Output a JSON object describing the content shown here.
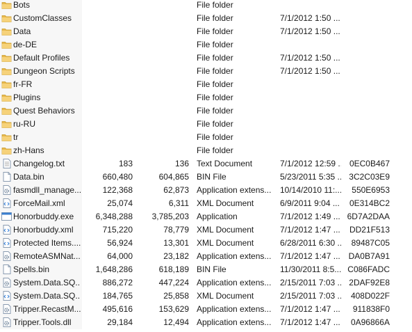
{
  "files": [
    {
      "name": "Bots",
      "size": "",
      "packed": "",
      "type": "File folder",
      "modified": "",
      "crc": "",
      "icon": "folder"
    },
    {
      "name": "CustomClasses",
      "size": "",
      "packed": "",
      "type": "File folder",
      "modified": "7/1/2012 1:50 ...",
      "crc": "",
      "icon": "folder"
    },
    {
      "name": "Data",
      "size": "",
      "packed": "",
      "type": "File folder",
      "modified": "7/1/2012 1:50 ...",
      "crc": "",
      "icon": "folder"
    },
    {
      "name": "de-DE",
      "size": "",
      "packed": "",
      "type": "File folder",
      "modified": "",
      "crc": "",
      "icon": "folder"
    },
    {
      "name": "Default Profiles",
      "size": "",
      "packed": "",
      "type": "File folder",
      "modified": "7/1/2012 1:50 ...",
      "crc": "",
      "icon": "folder"
    },
    {
      "name": "Dungeon Scripts",
      "size": "",
      "packed": "",
      "type": "File folder",
      "modified": "7/1/2012 1:50 ...",
      "crc": "",
      "icon": "folder"
    },
    {
      "name": "fr-FR",
      "size": "",
      "packed": "",
      "type": "File folder",
      "modified": "",
      "crc": "",
      "icon": "folder"
    },
    {
      "name": "Plugins",
      "size": "",
      "packed": "",
      "type": "File folder",
      "modified": "",
      "crc": "",
      "icon": "folder"
    },
    {
      "name": "Quest Behaviors",
      "size": "",
      "packed": "",
      "type": "File folder",
      "modified": "",
      "crc": "",
      "icon": "folder"
    },
    {
      "name": "ru-RU",
      "size": "",
      "packed": "",
      "type": "File folder",
      "modified": "",
      "crc": "",
      "icon": "folder"
    },
    {
      "name": "tr",
      "size": "",
      "packed": "",
      "type": "File folder",
      "modified": "",
      "crc": "",
      "icon": "folder"
    },
    {
      "name": "zh-Hans",
      "size": "",
      "packed": "",
      "type": "File folder",
      "modified": "",
      "crc": "",
      "icon": "folder"
    },
    {
      "name": "Changelog.txt",
      "size": "183",
      "packed": "136",
      "type": "Text Document",
      "modified": "7/1/2012 12:59 ...",
      "crc": "0EC0B467",
      "icon": "text"
    },
    {
      "name": "Data.bin",
      "size": "660,480",
      "packed": "604,865",
      "type": "BIN File",
      "modified": "5/23/2011 5:35 ...",
      "crc": "3C2C03E9",
      "icon": "blank"
    },
    {
      "name": "fasmdll_manage...",
      "size": "122,368",
      "packed": "62,873",
      "type": "Application extens...",
      "modified": "10/14/2010 11:...",
      "crc": "550E6953",
      "icon": "dll"
    },
    {
      "name": "ForceMail.xml",
      "size": "25,074",
      "packed": "6,311",
      "type": "XML Document",
      "modified": "6/9/2011 9:04 ...",
      "crc": "0E314BC2",
      "icon": "xml"
    },
    {
      "name": "Honorbuddy.exe",
      "size": "6,348,288",
      "packed": "3,785,203",
      "type": "Application",
      "modified": "7/1/2012 1:49 ...",
      "crc": "6D7A2DAA",
      "icon": "app"
    },
    {
      "name": "Honorbuddy.xml",
      "size": "715,220",
      "packed": "78,779",
      "type": "XML Document",
      "modified": "7/1/2012 1:47 ...",
      "crc": "DD21F513",
      "icon": "xml"
    },
    {
      "name": "Protected Items....",
      "size": "56,924",
      "packed": "13,301",
      "type": "XML Document",
      "modified": "6/28/2011 6:30 ...",
      "crc": "89487C05",
      "icon": "xml"
    },
    {
      "name": "RemoteASMNat...",
      "size": "64,000",
      "packed": "23,182",
      "type": "Application extens...",
      "modified": "7/1/2012 1:47 ...",
      "crc": "DA0B7A91",
      "icon": "dll"
    },
    {
      "name": "Spells.bin",
      "size": "1,648,286",
      "packed": "618,189",
      "type": "BIN File",
      "modified": "11/30/2011 8:5...",
      "crc": "C086FADC",
      "icon": "blank"
    },
    {
      "name": "System.Data.SQ...",
      "size": "886,272",
      "packed": "447,224",
      "type": "Application extens...",
      "modified": "2/15/2011 7:03 ...",
      "crc": "2DAF92E8",
      "icon": "dll"
    },
    {
      "name": "System.Data.SQ...",
      "size": "184,765",
      "packed": "25,858",
      "type": "XML Document",
      "modified": "2/15/2011 7:03 ...",
      "crc": "408D022F",
      "icon": "xml"
    },
    {
      "name": "Tripper.RecastM...",
      "size": "495,616",
      "packed": "153,629",
      "type": "Application extens...",
      "modified": "7/1/2012 1:47 ...",
      "crc": "911838F0",
      "icon": "dll"
    },
    {
      "name": "Tripper.Tools.dll",
      "size": "29,184",
      "packed": "12,494",
      "type": "Application extens...",
      "modified": "7/1/2012 1:47 ...",
      "crc": "0A96866A",
      "icon": "dll"
    }
  ],
  "colors": {
    "folder": "#e8b84a",
    "folder_dark": "#c99a2c",
    "doc_border": "#8a9bb0",
    "xml_accent": "#2e7bd6",
    "app_accent": "#3a7fd0",
    "dll_gear": "#6a7f96"
  }
}
